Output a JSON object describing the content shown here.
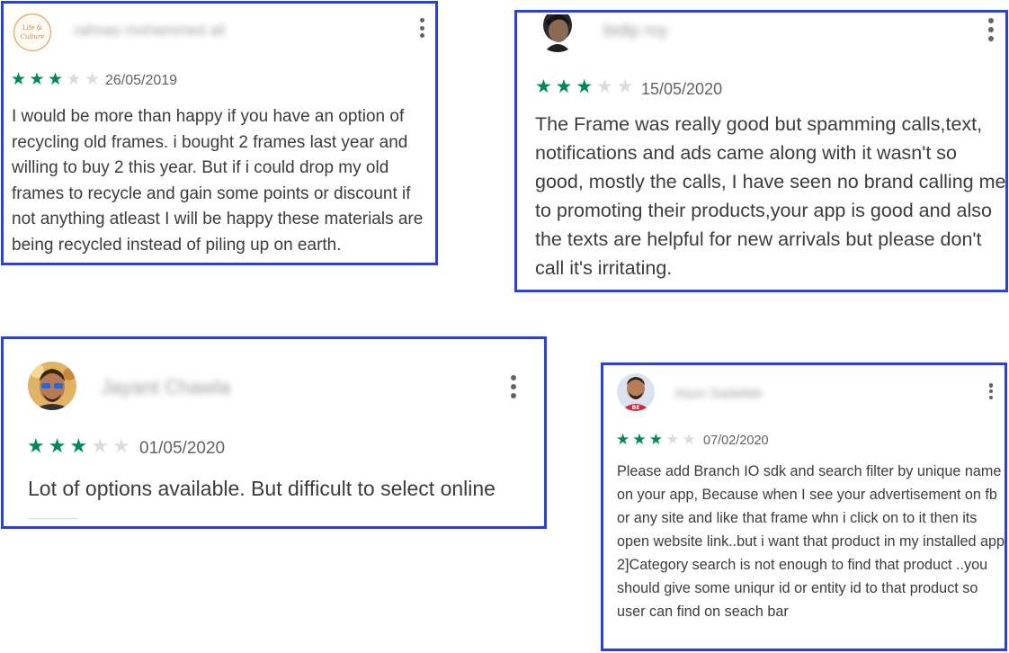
{
  "colors": {
    "border": "#2a3fe0",
    "star_filled": "#01875f",
    "star_empty": "#dadce0",
    "text": "#3c3c3c",
    "meta": "#5f6368"
  },
  "reviews": [
    {
      "reviewer_name": "rahnas mohammed ali",
      "avatar_icon": "logo-avatar-icon",
      "avatar_text": "Life & Culture",
      "rating": 3,
      "max_rating": 5,
      "date": "26/05/2019",
      "text": "I would be more than happy if you have an option of recycling old frames. i bought 2 frames last year and willing to buy 2 this year. But if i could drop my old frames to recycle and gain some points or discount if not anything atleast I will be happy these materials are being recycled instead of piling up on earth."
    },
    {
      "reviewer_name": "bidip roy",
      "avatar_icon": "person-avatar-icon",
      "rating": 3,
      "max_rating": 5,
      "date": "15/05/2020",
      "text": "The Frame was really good but spamming calls,text, notifications and ads came along with it wasn't so good, mostly the calls, I have seen no brand calling me to promoting their products,your app is good and also the texts are helpful for new arrivals but please don't call it's irritating."
    },
    {
      "reviewer_name": "Jayant Chawla",
      "avatar_icon": "person-avatar-icon",
      "rating": 3,
      "max_rating": 5,
      "date": "01/05/2020",
      "text": "Lot of options available. But difficult to select online"
    },
    {
      "reviewer_name": "Arjun Sadafale",
      "avatar_icon": "person-avatar-icon",
      "rating": 3,
      "max_rating": 5,
      "date": "07/02/2020",
      "text": "Please add Branch IO sdk and search filter by unique name on your app, Because when I see your advertisement on fb or any site and like that frame whn i click on to it then its open website link..but i want that product in my installed app 2]Category search is not enough to find that product ..you should give some uniqur id or entity id to that product so user can find on seach bar"
    }
  ]
}
